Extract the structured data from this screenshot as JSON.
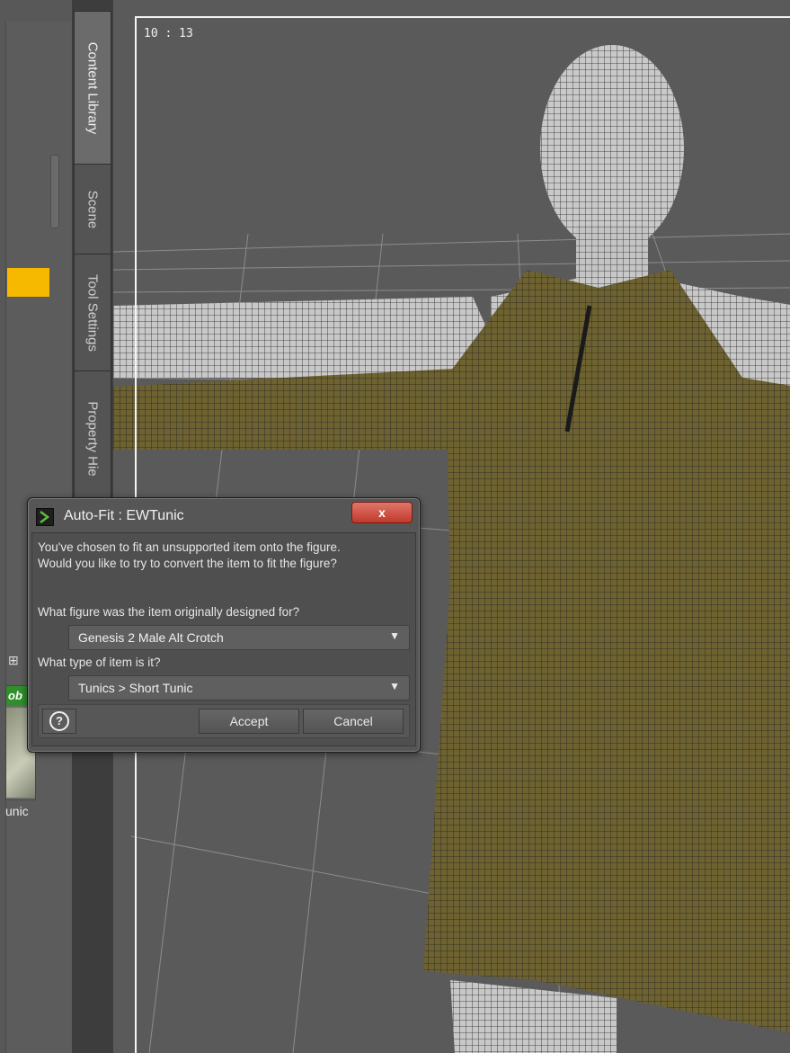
{
  "library": {
    "grid_icon": "⊞",
    "thumb_badge": "ob",
    "thumb_label": "unic"
  },
  "tabs": {
    "content_library": "Content Library",
    "scene": "Scene",
    "tool_settings": "Tool Settings",
    "property_hierarchy": "Property Hie"
  },
  "viewport": {
    "timecode": "10 : 13",
    "figure_colors": {
      "skin": "#c8c8c8",
      "tunic": "#6d6230"
    }
  },
  "dialog": {
    "title": "Auto-Fit : EWTunic",
    "close_label": "x",
    "message_line1": "You've chosen to fit an unsupported item onto the figure.",
    "message_line2": "Would you like to try to convert the item to fit the figure?",
    "question_figure": "What figure was the item originally designed for?",
    "figure_value": "Genesis 2 Male Alt Crotch",
    "question_type": "What type of item is it?",
    "type_value": "Tunics > Short Tunic",
    "help_label": "?",
    "accept_label": "Accept",
    "cancel_label": "Cancel"
  }
}
